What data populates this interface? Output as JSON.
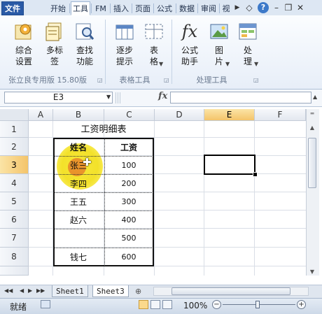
{
  "ribbon_tabs": {
    "file": "文件",
    "start": "开始",
    "tool": "工具",
    "fm": "FM",
    "insert": "插入",
    "layout": "页面",
    "formula": "公式",
    "data": "数据",
    "review": "审阅",
    "view": "视"
  },
  "ribbon": {
    "buttons": {
      "comprehensive_settings": "综合\n设置",
      "multi_label": "多标\n签",
      "lookup_function": "查找\n功能",
      "step_hint": "逐步\n提示",
      "table_format": "表\n格",
      "formula_helper": "公式\n助手",
      "image": "图\n片",
      "process": "处\n理"
    },
    "groups": {
      "version": "张立良专用版 15.80版",
      "table_tools": "表格工具",
      "process_tools": "处理工具"
    }
  },
  "formula_bar": {
    "name_box": "E3",
    "fx_label": "fx",
    "formula": ""
  },
  "grid": {
    "columns": [
      "A",
      "B",
      "C",
      "D",
      "E",
      "F"
    ],
    "rows": [
      "1",
      "2",
      "3",
      "4",
      "5",
      "6",
      "7",
      "8"
    ],
    "selected_column": "E",
    "selected_row": "3"
  },
  "sheet": {
    "title": "工资明细表",
    "header_name": "姓名",
    "header_salary": "工资",
    "rows": [
      {
        "name": "张三",
        "salary": "100"
      },
      {
        "name": "李四",
        "salary": "200"
      },
      {
        "name": "王五",
        "salary": "300"
      },
      {
        "name": "赵六",
        "salary": "400"
      },
      {
        "name": "",
        "salary": "500"
      },
      {
        "name": "钱七",
        "salary": "600"
      }
    ]
  },
  "sheet_tabs": [
    "Sheet1",
    "Sheet3"
  ],
  "status_bar": {
    "mode": "就绪",
    "zoom": "100%"
  },
  "colors": {
    "file_tab": "#2a5aa6",
    "highlight": "#f3e12a",
    "selected_header": "#f4c46a"
  }
}
